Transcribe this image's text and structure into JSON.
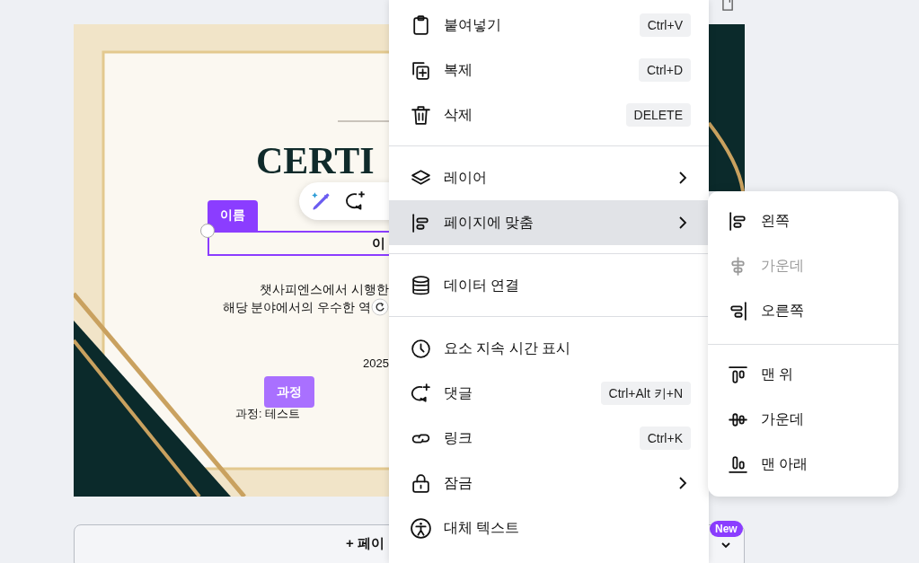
{
  "canvas": {
    "title": "CERTI",
    "name_tag": "이름",
    "name_field": "이",
    "body_lines": [
      "챗사피엔스에서 시행한",
      "해당 분야에서의 우수한 역"
    ],
    "date": "2025",
    "course_tag": "과정",
    "course_text": "과정: 테스트"
  },
  "add_page_button": {
    "label": "+ 페이"
  },
  "new_badge": "New",
  "context_menu": {
    "groups": [
      {
        "items": [
          {
            "label": "붙여넣기",
            "shortcut": "Ctrl+V",
            "has_submenu": false,
            "selected": false
          },
          {
            "label": "복제",
            "shortcut": "Ctrl+D",
            "has_submenu": false,
            "selected": false
          },
          {
            "label": "삭제",
            "shortcut": "DELETE",
            "has_submenu": false,
            "selected": false
          }
        ]
      },
      {
        "items": [
          {
            "label": "레이어",
            "has_submenu": true,
            "selected": false
          },
          {
            "label": "페이지에 맞춤",
            "has_submenu": true,
            "selected": true
          }
        ]
      },
      {
        "items": [
          {
            "label": "데이터 연결",
            "has_submenu": false,
            "selected": false
          }
        ]
      },
      {
        "items": [
          {
            "label": "요소 지속 시간 표시",
            "has_submenu": false,
            "selected": false
          },
          {
            "label": "댓글",
            "shortcut": "Ctrl+Alt 키+N",
            "has_submenu": false,
            "selected": false
          },
          {
            "label": "링크",
            "shortcut": "Ctrl+K",
            "has_submenu": false,
            "selected": false
          },
          {
            "label": "잠금",
            "has_submenu": true,
            "selected": false
          },
          {
            "label": "대체 텍스트",
            "has_submenu": false,
            "selected": false
          }
        ]
      }
    ]
  },
  "submenu": {
    "groups": [
      {
        "items": [
          {
            "label": "왼쪽",
            "disabled": false
          },
          {
            "label": "가운데",
            "disabled": true
          },
          {
            "label": "오른쪽",
            "disabled": false
          }
        ]
      },
      {
        "items": [
          {
            "label": "맨 위",
            "disabled": false
          },
          {
            "label": "가운데",
            "disabled": false
          },
          {
            "label": "맨 아래",
            "disabled": false
          }
        ]
      }
    ]
  }
}
